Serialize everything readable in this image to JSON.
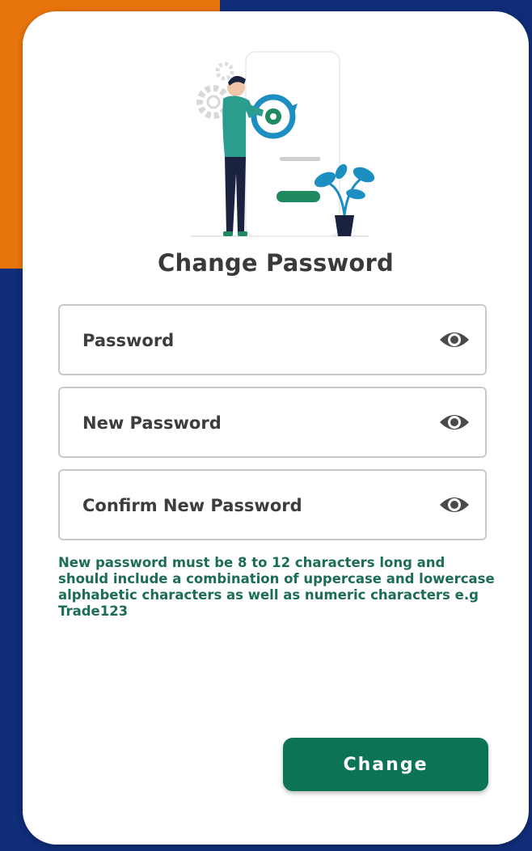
{
  "page": {
    "title": "Change Password"
  },
  "fields": [
    {
      "placeholder": "Password",
      "icon": "eye-icon"
    },
    {
      "placeholder": "New Password",
      "icon": "eye-icon"
    },
    {
      "placeholder": "Confirm New Password",
      "icon": "eye-icon"
    }
  ],
  "hint": "New password must be 8 to 12 characters long and should include a combination of uppercase and lowercase alphabetic characters as well as numeric characters e.g Trade123",
  "actions": {
    "change_label": "Change"
  },
  "colors": {
    "background": "#0f2d78",
    "accent_orange": "#e8740c",
    "primary_green": "#0d7356",
    "hint_green": "#1d6c58"
  }
}
